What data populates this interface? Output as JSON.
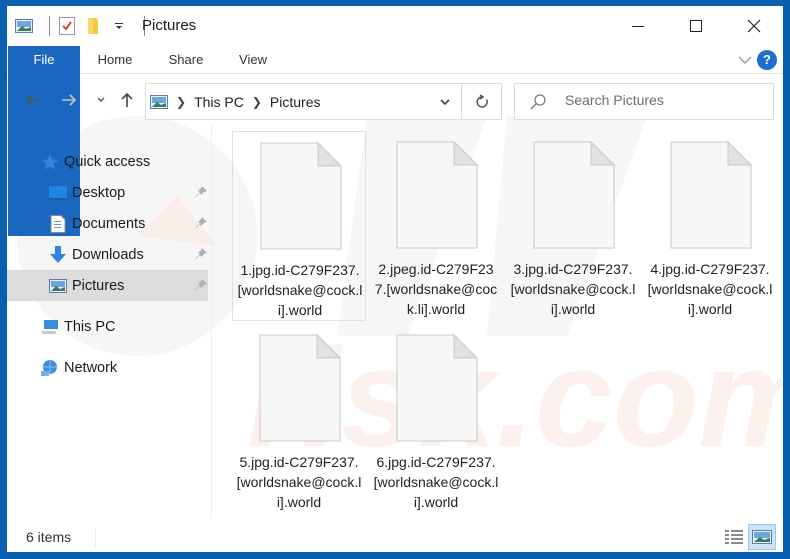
{
  "window": {
    "title": "Pictures",
    "quick_access_toolbar": [
      "pictures-icon",
      "properties-icon",
      "new-folder-icon",
      "customize-dropdown-icon"
    ],
    "controls": {
      "minimize": "minimize",
      "maximize": "maximize",
      "close": "close"
    }
  },
  "ribbon": {
    "tabs": [
      {
        "label": "File",
        "active": true
      },
      {
        "label": "Home"
      },
      {
        "label": "Share"
      },
      {
        "label": "View"
      }
    ],
    "help_label": "?",
    "accent_color": "#1a67c0"
  },
  "nav": {
    "breadcrumb": [
      "This PC",
      "Pictures"
    ],
    "search_placeholder": "Search Pictures"
  },
  "sidebar": {
    "items": [
      {
        "label": "Quick access",
        "icon": "star-icon",
        "level": 0
      },
      {
        "label": "Desktop",
        "icon": "desktop-icon",
        "level": 1,
        "pinned": true
      },
      {
        "label": "Documents",
        "icon": "documents-icon",
        "level": 1,
        "pinned": true
      },
      {
        "label": "Downloads",
        "icon": "downloads-icon",
        "level": 1,
        "pinned": true
      },
      {
        "label": "Pictures",
        "icon": "pictures-icon",
        "level": 1,
        "pinned": true,
        "selected": true
      },
      {
        "label": "This PC",
        "icon": "computer-icon",
        "level": 0
      },
      {
        "label": "Network",
        "icon": "network-icon",
        "level": 0
      }
    ]
  },
  "files": [
    {
      "name": "1.jpg.id-C279F237.[worldsnake@cock.li].world",
      "focused": true
    },
    {
      "name": "2.jpeg.id-C279F237.[worldsnake@cock.li].world"
    },
    {
      "name": "3.jpg.id-C279F237.[worldsnake@cock.li].world"
    },
    {
      "name": "4.jpg.id-C279F237.[worldsnake@cock.li].world"
    },
    {
      "name": "5.jpg.id-C279F237.[worldsnake@cock.li].world"
    },
    {
      "name": "6.jpg.id-C279F237.[worldsnake@cock.li].world"
    }
  ],
  "status": {
    "item_count": "6 items",
    "view_modes": [
      "details-view",
      "large-icons-view"
    ],
    "active_view": "large-icons-view"
  }
}
